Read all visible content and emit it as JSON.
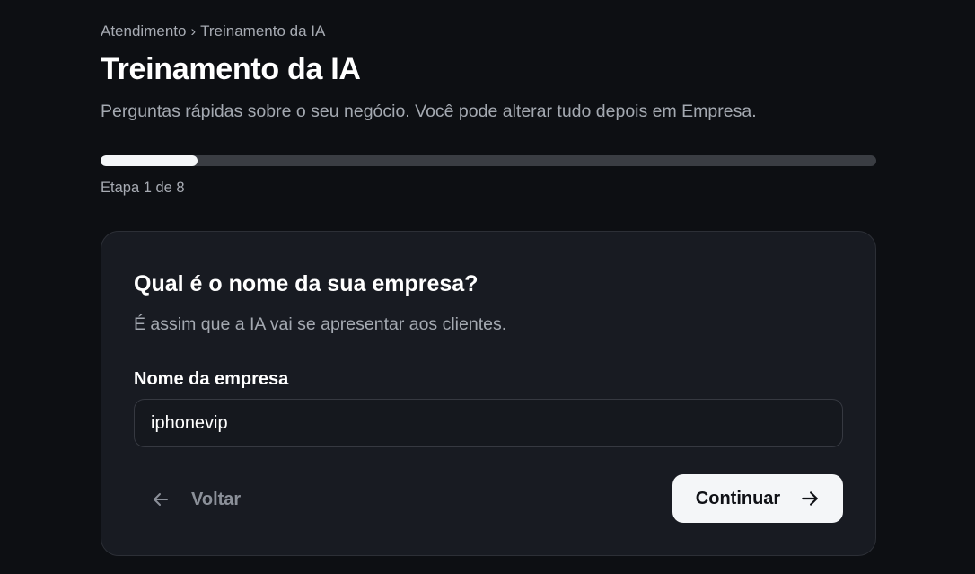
{
  "breadcrumb": {
    "items": [
      "Atendimento",
      "Treinamento da IA"
    ],
    "separator": "›"
  },
  "header": {
    "title": "Treinamento da IA",
    "subtitle": "Perguntas rápidas sobre o seu negócio. Você pode alterar tudo depois em Empresa."
  },
  "progress": {
    "current_step": 1,
    "total_steps": 8,
    "fraction": 0.125,
    "label": "Etapa 1 de 8"
  },
  "card": {
    "question": "Qual é o nome da sua empresa?",
    "hint": "É assim que a IA vai se apresentar aos clientes.",
    "field_label": "Nome da empresa",
    "field_value": "iphonevip",
    "back_label": "Voltar",
    "back_icon": "arrow-left-icon",
    "continue_label": "Continuar",
    "continue_icon": "arrow-right-icon"
  },
  "colors": {
    "background": "#0d0f13",
    "card": "#181b22",
    "progress_fill": "#f4f6f8",
    "progress_track": "#3a3d43",
    "primary_button": "#f4f6f8",
    "muted_text": "#a4a9b1"
  }
}
